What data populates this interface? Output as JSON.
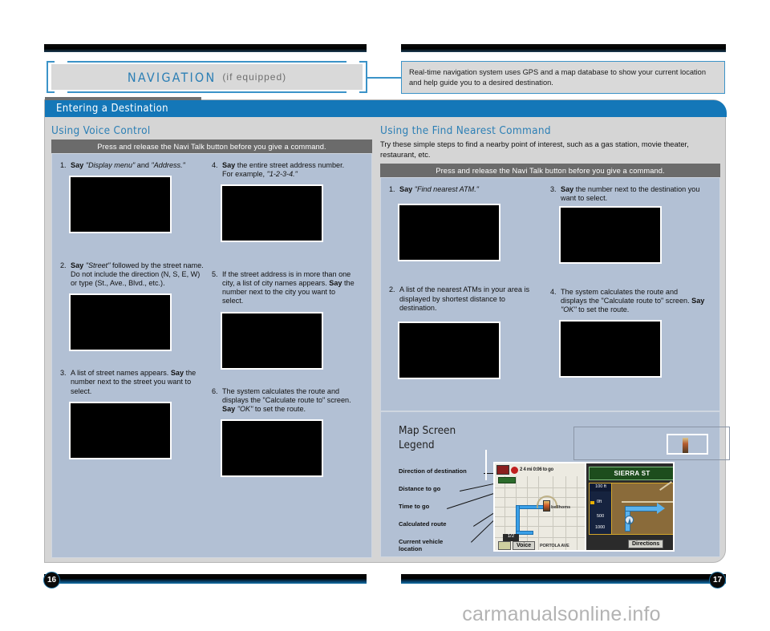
{
  "document": {
    "title_main": "NAVIGATION",
    "title_suffix": "(if equipped)",
    "intro_blurb": "Real-time navigation system uses GPS and a map database to show your current location and help guide you to a desired destination.",
    "section_header": "Entering a Destination",
    "page_left": "16",
    "page_right": "17",
    "watermark": "carmanualsonline.info"
  },
  "voice_control": {
    "title": "Using Voice Control",
    "instruction_bar": "Press and release the Navi Talk button before you give a command.",
    "steps": [
      {
        "num": "1.",
        "html": "<b>Say</b> <i>\"Display menu\"</i> and <i>\"Address.\"</i>",
        "screenshot": "navigation-screen-capture"
      },
      {
        "num": "2.",
        "html": "<b>Say</b> <i>\"Street\"</i> followed by the street name. Do not include the direction (N, S, E, W) or type (St., Ave., Blvd., etc.).",
        "screenshot": "navigation-screen-capture"
      },
      {
        "num": "3.",
        "html": "A list of street names appears. <b>Say</b> the number next to the street you want to select.",
        "screenshot": "navigation-screen-capture"
      },
      {
        "num": "4.",
        "html": "<b>Say</b> the entire street address number. For example, <i>\"1-2-3-4.\"</i>",
        "screenshot": "navigation-screen-capture"
      },
      {
        "num": "5.",
        "html": "If the street address is in more than one city, a list of city names appears. <b>Say</b> the number next to the city you want to select.",
        "screenshot": "navigation-screen-capture"
      },
      {
        "num": "6.",
        "html": "The system calculates the route and displays the \"Calculate route to\" screen. <b>Say</b> <i>\"OK\"</i> to set the route.",
        "screenshot": "navigation-screen-capture"
      }
    ]
  },
  "find_nearest": {
    "title": "Using the Find Nearest Command",
    "subtitle": "Try these simple steps to find a nearby point of interest, such as a gas station, movie theater, restaurant, etc.",
    "instruction_bar": "Press and release the Navi Talk button before you give a command.",
    "steps": [
      {
        "num": "1.",
        "html": "<b>Say</b> <i>\"Find nearest ATM.\"</i>",
        "screenshot": "navigation-screen-capture"
      },
      {
        "num": "2.",
        "html": "A list of the nearest ATMs in your area is displayed by shortest distance to destination.",
        "screenshot": "navigation-screen-capture"
      },
      {
        "num": "3.",
        "html": "<b>Say</b> the number next to the destination you want to select.",
        "screenshot": "navigation-screen-capture"
      },
      {
        "num": "4.",
        "html": "The system calculates the route and displays the \"Calculate route to\" screen. <b>Say</b> <i>\"OK\"</i> to set the route.",
        "screenshot": "navigation-screen-capture"
      }
    ]
  },
  "map_legend": {
    "title_line1": "Map Screen",
    "title_line2": "Legend",
    "labels": [
      "Direction of destination",
      "Distance to go",
      "Time to go",
      "Calculated route",
      "Current vehicle\nlocation"
    ]
  },
  "map_screen": {
    "top_info": "2 4 mi 0:06 to go",
    "guidance_street": "SIERRA ST",
    "scale_top": "100 ft",
    "scale_labels": [
      "0ft",
      "500",
      "1000"
    ],
    "voice_button": "Voice",
    "directions_button": "Directions",
    "street_label_1": "PORTOLA AVE",
    "street_label_2": "bellhoms",
    "zoom_chip": "1/2"
  },
  "colors": {
    "accent_blue": "#1477b8",
    "title_blue": "#2c7fb5",
    "panel_blue": "#b2c0d4",
    "card_gray": "#d5d5d5",
    "bar_gray": "#6b6b6b"
  }
}
